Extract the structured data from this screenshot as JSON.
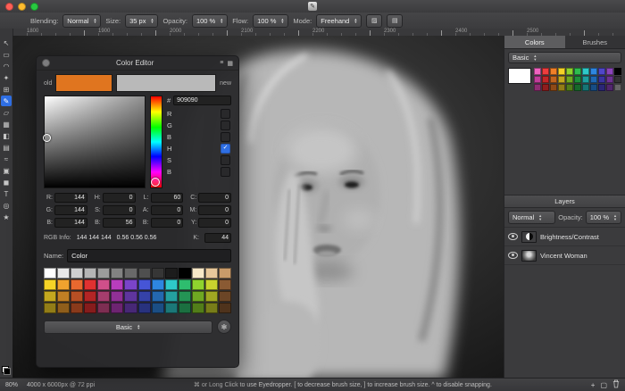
{
  "toolbar": {
    "blending_label": "Blending:",
    "blending_value": "Normal",
    "size_label": "Size:",
    "size_value": "35 px",
    "opacity_label": "Opacity:",
    "opacity_value": "100 %",
    "flow_label": "Flow:",
    "flow_value": "100 %",
    "mode_label": "Mode:",
    "mode_value": "Freehand"
  },
  "ruler": {
    "labels": [
      "1800",
      "1900",
      "2000",
      "2100",
      "2200",
      "2300",
      "2400",
      "2500"
    ]
  },
  "tools": {
    "items": [
      {
        "name": "move-tool",
        "glyph": "↖",
        "active": false
      },
      {
        "name": "marquee-tool",
        "glyph": "▭",
        "active": false
      },
      {
        "name": "lasso-tool",
        "glyph": "◠",
        "active": false
      },
      {
        "name": "magic-wand-tool",
        "glyph": "✦",
        "active": false
      },
      {
        "name": "crop-tool",
        "glyph": "⊞",
        "active": false
      },
      {
        "name": "paint-tool",
        "glyph": "✎",
        "active": true
      },
      {
        "name": "eraser-tool",
        "glyph": "▱",
        "active": false
      },
      {
        "name": "pixel-tool",
        "glyph": "▦",
        "active": false
      },
      {
        "name": "fill-tool",
        "glyph": "◧",
        "active": false
      },
      {
        "name": "gradient-tool",
        "glyph": "▤",
        "active": false
      },
      {
        "name": "smudge-tool",
        "glyph": "≈",
        "active": false
      },
      {
        "name": "clone-tool",
        "glyph": "▣",
        "active": false
      },
      {
        "name": "shape-tool",
        "glyph": "◼",
        "active": false
      },
      {
        "name": "type-tool",
        "glyph": "T",
        "active": false
      },
      {
        "name": "zoom-tool",
        "glyph": "◎",
        "active": false
      },
      {
        "name": "star-tool",
        "glyph": "★",
        "active": false
      }
    ]
  },
  "color_editor": {
    "title": "Color Editor",
    "old_label": "old",
    "new_label": "new",
    "old_color": "#e0751f",
    "new_color": "#b9b9b9",
    "hex_label": "#",
    "hex_value": "909090",
    "check_glyph": "✓",
    "channel_rows": [
      {
        "label": "R",
        "checked": false
      },
      {
        "label": "G",
        "checked": false
      },
      {
        "label": "B",
        "checked": false
      },
      {
        "label": "H",
        "checked": true
      },
      {
        "label": "S",
        "checked": false
      },
      {
        "label": "B",
        "checked": false
      }
    ],
    "fields": [
      {
        "label": "R:",
        "value": "144"
      },
      {
        "label": "H:",
        "value": "0"
      },
      {
        "label": "L:",
        "value": "60"
      },
      {
        "label": "C:",
        "value": "0"
      },
      {
        "label": "G:",
        "value": "144"
      },
      {
        "label": "S:",
        "value": "0"
      },
      {
        "label": "A:",
        "value": "0"
      },
      {
        "label": "M:",
        "value": "0"
      },
      {
        "label": "B:",
        "value": "144"
      },
      {
        "label": "B:",
        "value": "56"
      },
      {
        "label": "B:",
        "value": "0"
      },
      {
        "label": "Y:",
        "value": "0"
      }
    ],
    "rgb_info_label": "RGB Info:",
    "rgb_values": "144 144 144",
    "rgb_fractions": "0.56 0.56 0.56",
    "k_label": "K:",
    "k_value": "44",
    "name_label": "Name:",
    "name_value": "Color",
    "preset_label": "Basic",
    "palette": [
      [
        "#ffffff",
        "#e8e8e8",
        "#cfcfcf",
        "#b5b5b5",
        "#9c9c9c",
        "#828282",
        "#696969",
        "#4f4f4f",
        "#363636",
        "#1c1c1c",
        "#000000",
        "#f7e8c8",
        "#e8c89b",
        "#c89b6a"
      ],
      [
        "#f5d327",
        "#f0a22e",
        "#e8682f",
        "#e03131",
        "#d04f8a",
        "#b83dbd",
        "#7a44c9",
        "#4655d6",
        "#2e86e0",
        "#2ec9c9",
        "#2ebd6e",
        "#8fd32e",
        "#c9d32e",
        "#8a5a33"
      ],
      [
        "#c4a81f",
        "#c07f24",
        "#b84f24",
        "#b32525",
        "#a63d6d",
        "#913096",
        "#5f359e",
        "#3542a8",
        "#2468b0",
        "#24a0a0",
        "#249455",
        "#6fa822",
        "#a0a822",
        "#6b4526"
      ],
      [
        "#927d17",
        "#8f5e1b",
        "#8a3a1b",
        "#861c1c",
        "#7d2e52",
        "#6d2471",
        "#472876",
        "#28327e",
        "#1b4e84",
        "#1b7878",
        "#1b6f40",
        "#527d19",
        "#787d19",
        "#4f331c"
      ]
    ]
  },
  "right_panel": {
    "tabs": [
      {
        "label": "Colors",
        "active": true
      },
      {
        "label": "Brushes",
        "active": false
      }
    ],
    "preset_label": "Basic",
    "current_color": "#ffffff",
    "palette": [
      [
        "#f062c0",
        "#ee3d3d",
        "#f07f28",
        "#f5d327",
        "#8fd32e",
        "#2ebd4e",
        "#2ec9c9",
        "#2e86e0",
        "#4f46c9",
        "#8a44b8",
        "#000000"
      ],
      [
        "#c03d9a",
        "#c02727",
        "#c0641f",
        "#c4a81f",
        "#6fa822",
        "#1f8f3a",
        "#1f9e9e",
        "#1f68b3",
        "#3a34a0",
        "#6d3392",
        "#333333"
      ],
      [
        "#8f2d73",
        "#8f1d1d",
        "#8f4a17",
        "#927d17",
        "#527d19",
        "#17692b",
        "#177575",
        "#174d85",
        "#2b2677",
        "#51266d",
        "#666666"
      ]
    ],
    "layers": {
      "title": "Layers",
      "blend_value": "Normal",
      "opacity_label": "Opacity:",
      "opacity_value": "100 %",
      "items": [
        {
          "name": "Brightness/Contrast",
          "type": "adjustment"
        },
        {
          "name": "Vincent Woman",
          "type": "image"
        }
      ]
    }
  },
  "statusbar": {
    "zoom": "80%",
    "doc_info": "4000 x 6000px @ 72 ppi",
    "hint": "⌘ or Long Click to use Eyedropper. [ to decrease brush size, ] to increase brush size. ^ to disable snapping."
  }
}
